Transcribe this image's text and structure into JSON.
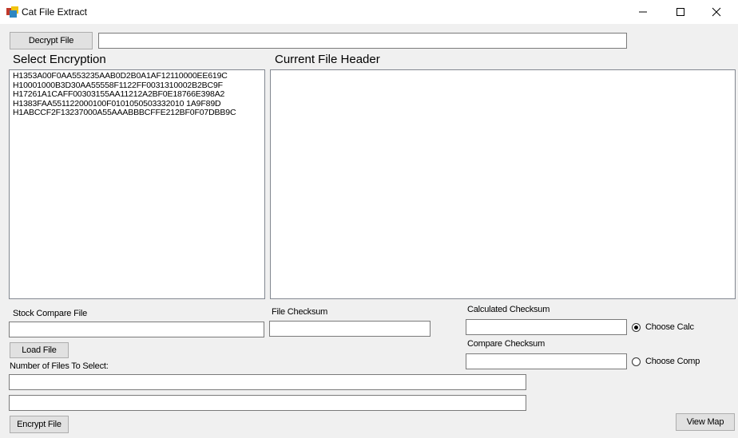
{
  "window": {
    "title": "Cat File Extract",
    "controls": {
      "minimize": "minimize-icon",
      "maximize": "maximize-icon",
      "close": "close-icon"
    }
  },
  "decrypt": {
    "button_label": "Decrypt File",
    "path_value": ""
  },
  "encryption": {
    "heading": "Select Encryption",
    "items": [
      "H1353A00F0AA553235AAB0D2B0A1AF12110000EE619C",
      "H10001000B3D30AA55558F1122FF0031310002B2BC9F",
      "H17261A1CAFF00303155AA11212A2BF0E18766E398A2",
      "H1383FAA551122000100F0101050503332010 1A9F89D",
      "H1ABCCF2F13237000A55AAABBBCFFE212BF0F07DBB9C"
    ]
  },
  "header": {
    "heading": "Current File Header"
  },
  "stock": {
    "label": "Stock Compare File",
    "value": "",
    "load_button": "Load File"
  },
  "file_checksum": {
    "label": "File Checksum",
    "value": ""
  },
  "calculated": {
    "label": "Calculated Checksum",
    "value": "",
    "radio_label": "Choose Calc",
    "selected": true
  },
  "compare": {
    "label": "Compare Checksum",
    "value": "",
    "radio_label": "Choose Comp",
    "selected": false
  },
  "select_count": {
    "label": "Number of Files To Select:",
    "field1": "",
    "field2": ""
  },
  "encrypt": {
    "button_label": "Encrypt File"
  },
  "view_map": {
    "button_label": "View Map"
  }
}
